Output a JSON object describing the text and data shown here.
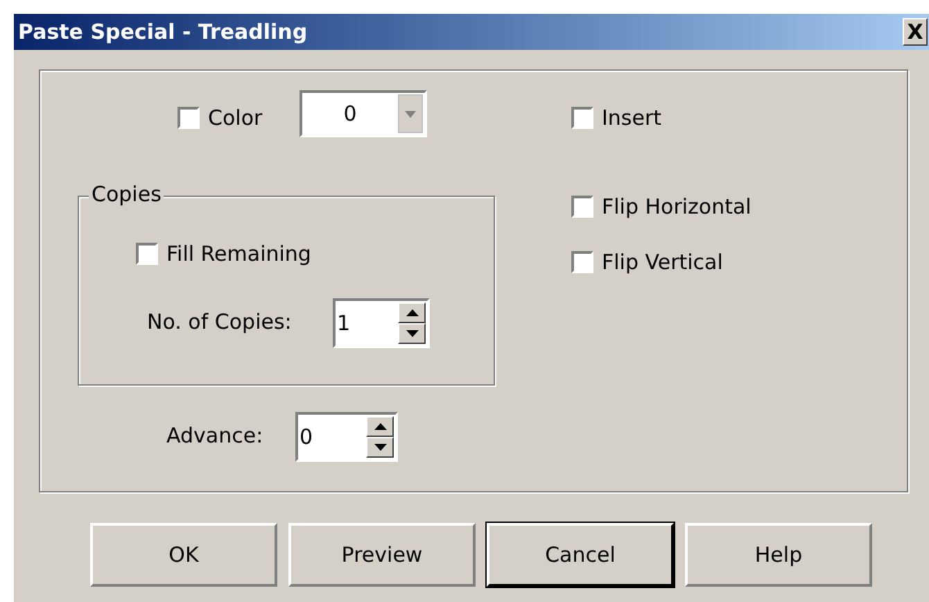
{
  "window": {
    "title": "Paste Special - Treadling",
    "close": "X"
  },
  "color": {
    "label": "Color",
    "checked": false,
    "value": "0"
  },
  "options": [
    {
      "label": "Insert",
      "checked": false
    },
    {
      "label": "Flip Horizontal",
      "checked": false
    },
    {
      "label": "Flip Vertical",
      "checked": false
    }
  ],
  "copies": {
    "title": "Copies",
    "fill_remaining": {
      "label": "Fill Remaining",
      "checked": false
    },
    "count": {
      "label": "No. of Copies:",
      "value": "1"
    }
  },
  "advance": {
    "label": "Advance:",
    "value": "0"
  },
  "buttons": [
    {
      "label": "OK",
      "default": false
    },
    {
      "label": "Preview",
      "default": false
    },
    {
      "label": "Cancel",
      "default": true
    },
    {
      "label": "Help",
      "default": false
    }
  ]
}
